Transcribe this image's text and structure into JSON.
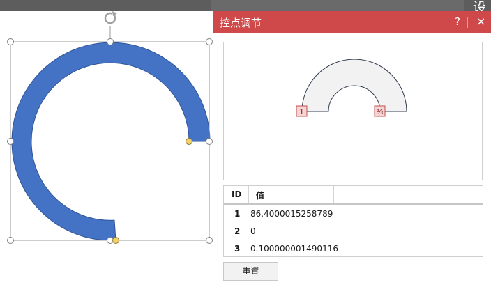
{
  "ribbon": {
    "tab_text": "设置"
  },
  "panel": {
    "title": "控点调节",
    "help_label": "?",
    "close_label": "×",
    "preview": {
      "marker_1": "1",
      "marker_2": "⅔"
    },
    "table": {
      "headers": [
        "ID",
        "值",
        ""
      ],
      "rows": [
        {
          "id": "1",
          "value": "86.4000015258789"
        },
        {
          "id": "2",
          "value": "0"
        },
        {
          "id": "3",
          "value": "0.100000001490116"
        }
      ]
    },
    "reset_label": "重置"
  },
  "canvas": {
    "shape_color": "#4472c4",
    "adjust_handle_color": "#f2d06b",
    "rotate_icon": "rotate-handle-icon"
  }
}
